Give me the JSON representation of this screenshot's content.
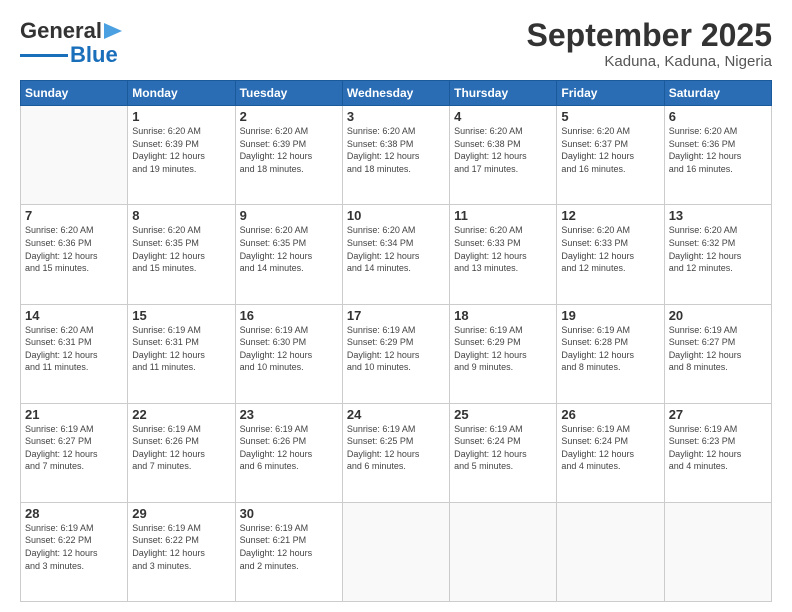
{
  "header": {
    "logo_line1": "General",
    "logo_line2": "Blue",
    "title": "September 2025",
    "subtitle": "Kaduna, Kaduna, Nigeria"
  },
  "calendar": {
    "days_of_week": [
      "Sunday",
      "Monday",
      "Tuesday",
      "Wednesday",
      "Thursday",
      "Friday",
      "Saturday"
    ],
    "weeks": [
      [
        {
          "day": "",
          "info": ""
        },
        {
          "day": "1",
          "info": "Sunrise: 6:20 AM\nSunset: 6:39 PM\nDaylight: 12 hours\nand 19 minutes."
        },
        {
          "day": "2",
          "info": "Sunrise: 6:20 AM\nSunset: 6:39 PM\nDaylight: 12 hours\nand 18 minutes."
        },
        {
          "day": "3",
          "info": "Sunrise: 6:20 AM\nSunset: 6:38 PM\nDaylight: 12 hours\nand 18 minutes."
        },
        {
          "day": "4",
          "info": "Sunrise: 6:20 AM\nSunset: 6:38 PM\nDaylight: 12 hours\nand 17 minutes."
        },
        {
          "day": "5",
          "info": "Sunrise: 6:20 AM\nSunset: 6:37 PM\nDaylight: 12 hours\nand 16 minutes."
        },
        {
          "day": "6",
          "info": "Sunrise: 6:20 AM\nSunset: 6:36 PM\nDaylight: 12 hours\nand 16 minutes."
        }
      ],
      [
        {
          "day": "7",
          "info": "Sunrise: 6:20 AM\nSunset: 6:36 PM\nDaylight: 12 hours\nand 15 minutes."
        },
        {
          "day": "8",
          "info": "Sunrise: 6:20 AM\nSunset: 6:35 PM\nDaylight: 12 hours\nand 15 minutes."
        },
        {
          "day": "9",
          "info": "Sunrise: 6:20 AM\nSunset: 6:35 PM\nDaylight: 12 hours\nand 14 minutes."
        },
        {
          "day": "10",
          "info": "Sunrise: 6:20 AM\nSunset: 6:34 PM\nDaylight: 12 hours\nand 14 minutes."
        },
        {
          "day": "11",
          "info": "Sunrise: 6:20 AM\nSunset: 6:33 PM\nDaylight: 12 hours\nand 13 minutes."
        },
        {
          "day": "12",
          "info": "Sunrise: 6:20 AM\nSunset: 6:33 PM\nDaylight: 12 hours\nand 12 minutes."
        },
        {
          "day": "13",
          "info": "Sunrise: 6:20 AM\nSunset: 6:32 PM\nDaylight: 12 hours\nand 12 minutes."
        }
      ],
      [
        {
          "day": "14",
          "info": "Sunrise: 6:20 AM\nSunset: 6:31 PM\nDaylight: 12 hours\nand 11 minutes."
        },
        {
          "day": "15",
          "info": "Sunrise: 6:19 AM\nSunset: 6:31 PM\nDaylight: 12 hours\nand 11 minutes."
        },
        {
          "day": "16",
          "info": "Sunrise: 6:19 AM\nSunset: 6:30 PM\nDaylight: 12 hours\nand 10 minutes."
        },
        {
          "day": "17",
          "info": "Sunrise: 6:19 AM\nSunset: 6:29 PM\nDaylight: 12 hours\nand 10 minutes."
        },
        {
          "day": "18",
          "info": "Sunrise: 6:19 AM\nSunset: 6:29 PM\nDaylight: 12 hours\nand 9 minutes."
        },
        {
          "day": "19",
          "info": "Sunrise: 6:19 AM\nSunset: 6:28 PM\nDaylight: 12 hours\nand 8 minutes."
        },
        {
          "day": "20",
          "info": "Sunrise: 6:19 AM\nSunset: 6:27 PM\nDaylight: 12 hours\nand 8 minutes."
        }
      ],
      [
        {
          "day": "21",
          "info": "Sunrise: 6:19 AM\nSunset: 6:27 PM\nDaylight: 12 hours\nand 7 minutes."
        },
        {
          "day": "22",
          "info": "Sunrise: 6:19 AM\nSunset: 6:26 PM\nDaylight: 12 hours\nand 7 minutes."
        },
        {
          "day": "23",
          "info": "Sunrise: 6:19 AM\nSunset: 6:26 PM\nDaylight: 12 hours\nand 6 minutes."
        },
        {
          "day": "24",
          "info": "Sunrise: 6:19 AM\nSunset: 6:25 PM\nDaylight: 12 hours\nand 6 minutes."
        },
        {
          "day": "25",
          "info": "Sunrise: 6:19 AM\nSunset: 6:24 PM\nDaylight: 12 hours\nand 5 minutes."
        },
        {
          "day": "26",
          "info": "Sunrise: 6:19 AM\nSunset: 6:24 PM\nDaylight: 12 hours\nand 4 minutes."
        },
        {
          "day": "27",
          "info": "Sunrise: 6:19 AM\nSunset: 6:23 PM\nDaylight: 12 hours\nand 4 minutes."
        }
      ],
      [
        {
          "day": "28",
          "info": "Sunrise: 6:19 AM\nSunset: 6:22 PM\nDaylight: 12 hours\nand 3 minutes."
        },
        {
          "day": "29",
          "info": "Sunrise: 6:19 AM\nSunset: 6:22 PM\nDaylight: 12 hours\nand 3 minutes."
        },
        {
          "day": "30",
          "info": "Sunrise: 6:19 AM\nSunset: 6:21 PM\nDaylight: 12 hours\nand 2 minutes."
        },
        {
          "day": "",
          "info": ""
        },
        {
          "day": "",
          "info": ""
        },
        {
          "day": "",
          "info": ""
        },
        {
          "day": "",
          "info": ""
        }
      ]
    ]
  }
}
